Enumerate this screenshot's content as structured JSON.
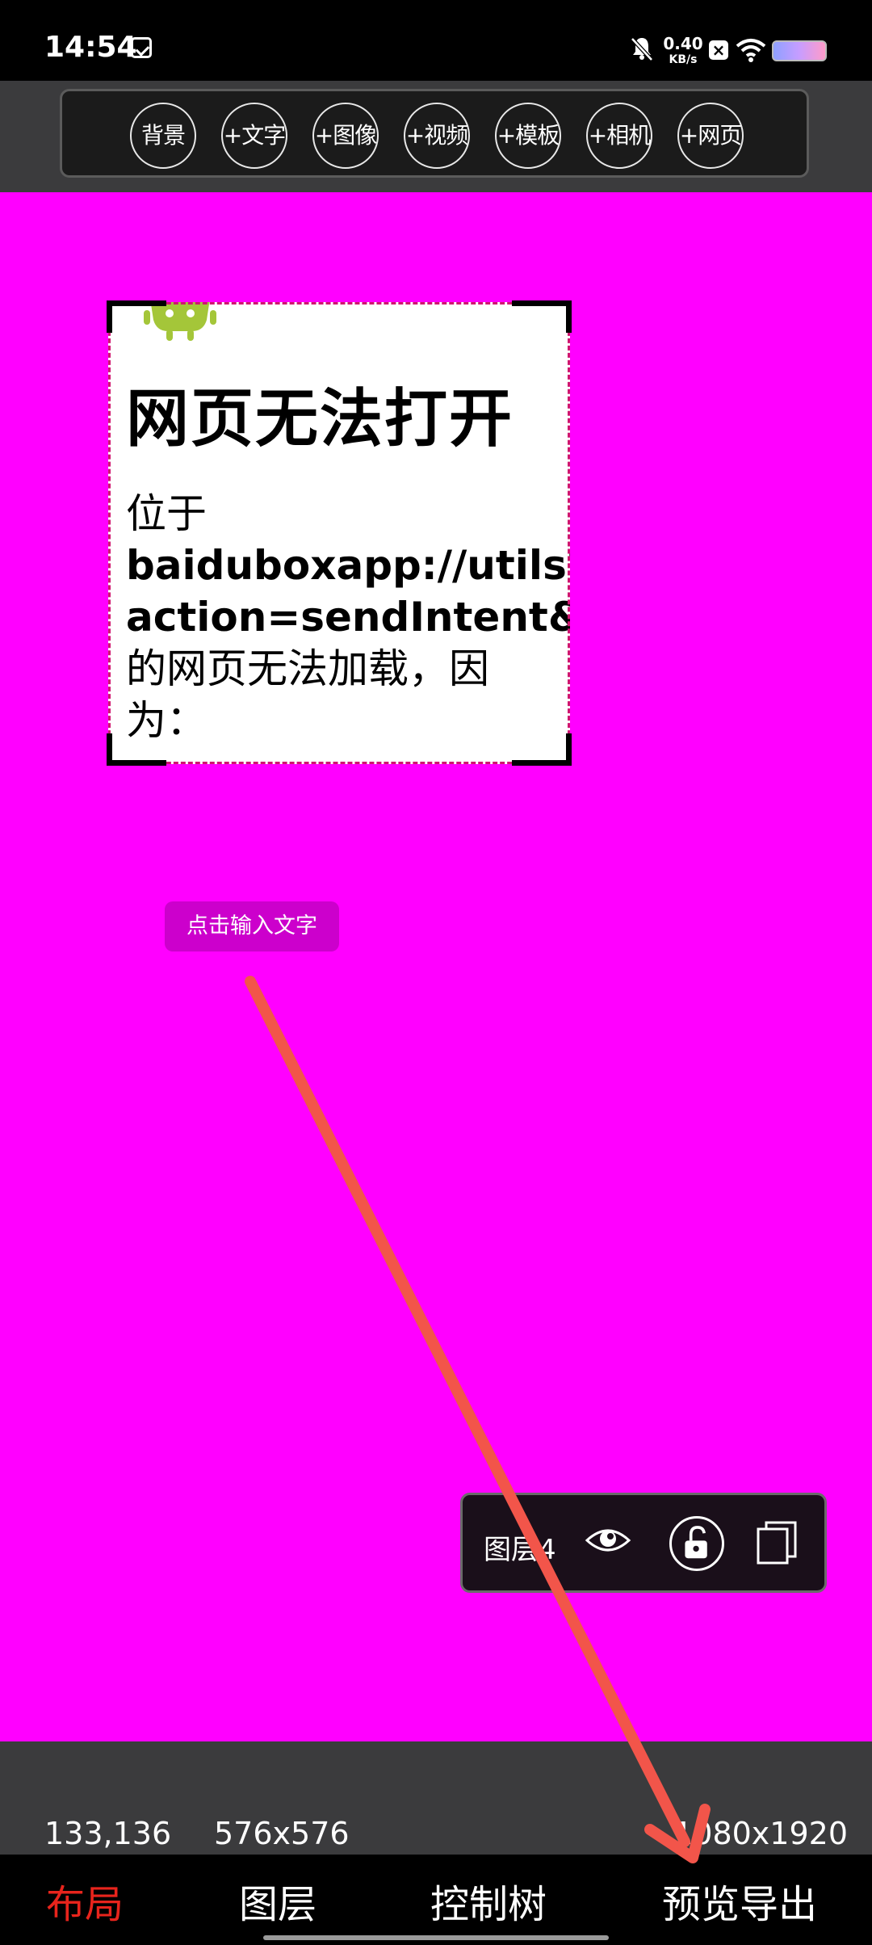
{
  "status_bar": {
    "time": "14:54",
    "net_speed_value": "0.40",
    "net_speed_unit": "KB/s",
    "icons": [
      "calendar-icon",
      "bell-muted-icon",
      "close-box-icon",
      "wifi-icon",
      "battery-icon"
    ]
  },
  "toolbar": {
    "buttons": [
      "背景",
      "+文字",
      "+图像",
      "+视频",
      "+模板",
      "+相机",
      "+网页"
    ]
  },
  "canvas": {
    "background_color": "#ff00ff",
    "web_element": {
      "title": "网页无法打开",
      "body_line1": "位于",
      "url_line1": "baiduboxapp://utils?",
      "url_line2": "action=sendIntent&m",
      "body_line2": "的网页无法加载，因",
      "body_line3": "为："
    },
    "text_placeholder": "点击输入文字"
  },
  "layer_panel": {
    "layer_name": "图层4",
    "icons": [
      "eye-icon",
      "unlock-icon",
      "copy-icon"
    ]
  },
  "info_bar": {
    "position": "133,136",
    "size": "576x576",
    "canvas_size": "1080x1920"
  },
  "bottom_nav": {
    "items": [
      "布局",
      "图层",
      "控制树",
      "预览导出"
    ],
    "active_color": "#e8241c"
  }
}
